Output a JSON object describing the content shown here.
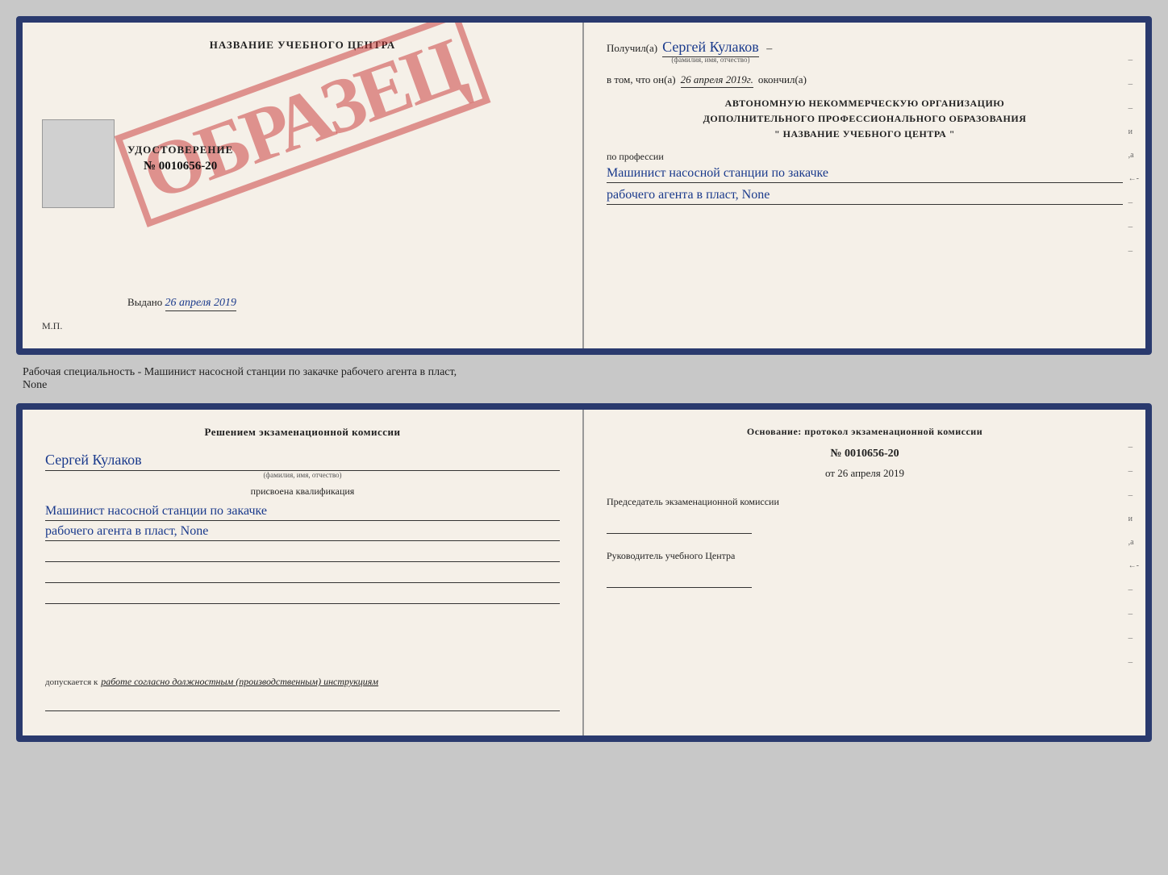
{
  "top_doc": {
    "left": {
      "title": "НАЗВАНИЕ УЧЕБНОГО ЦЕНТРА",
      "stamp": "ОБРАЗЕЦ",
      "udostoverenie_label": "УДОСТОВЕРЕНИЕ",
      "number": "№ 0010656-20",
      "vydano_label": "Выдано",
      "vydano_date": "26 апреля 2019",
      "mp": "М.П."
    },
    "right": {
      "poluchil": "Получил(а)",
      "fio": "Сергей Кулаков",
      "fio_hint": "(фамилия, имя, отчество)",
      "vtom": "в том, что он(а)",
      "date": "26 апреля 2019г.",
      "okoncil": "окончил(а)",
      "org_line1": "АВТОНОМНУЮ НЕКОММЕРЧЕСКУЮ ОРГАНИЗАЦИЮ",
      "org_line2": "ДОПОЛНИТЕЛЬНОГО ПРОФЕССИОНАЛЬНОГО ОБРАЗОВАНИЯ",
      "org_name": "\"   НАЗВАНИЕ УЧЕБНОГО ЦЕНТРА   \"",
      "po_professii": "по профессии",
      "profession1": "Машинист насосной станции по закачке",
      "profession2": "рабочего агента в пласт, None"
    }
  },
  "middle": {
    "text": "Рабочая специальность - Машинист насосной станции по закачке рабочего агента в пласт,",
    "text2": "None"
  },
  "bottom_doc": {
    "left": {
      "resheniem": "Решением экзаменационной комиссии",
      "fio": "Сергей Кулаков",
      "fio_hint": "(фамилия, имя, отчество)",
      "prisvoena": "присвоена квалификация",
      "kvalif1": "Машинист насосной станции по закачке",
      "kvalif2": "рабочего агента в пласт, None",
      "dopuskaetsya_prefix": "допускается к",
      "dopuskaetsya_text": "работе согласно должностным (производственным) инструкциям"
    },
    "right": {
      "osnovanie": "Основание: протокол экзаменационной комиссии",
      "protocol_num": "№ 0010656-20",
      "ot_label": "от",
      "ot_date": "26 апреля 2019",
      "chairman_label": "Председатель экзаменационной комиссии",
      "rukovoditel_label": "Руководитель учебного Центра"
    }
  }
}
